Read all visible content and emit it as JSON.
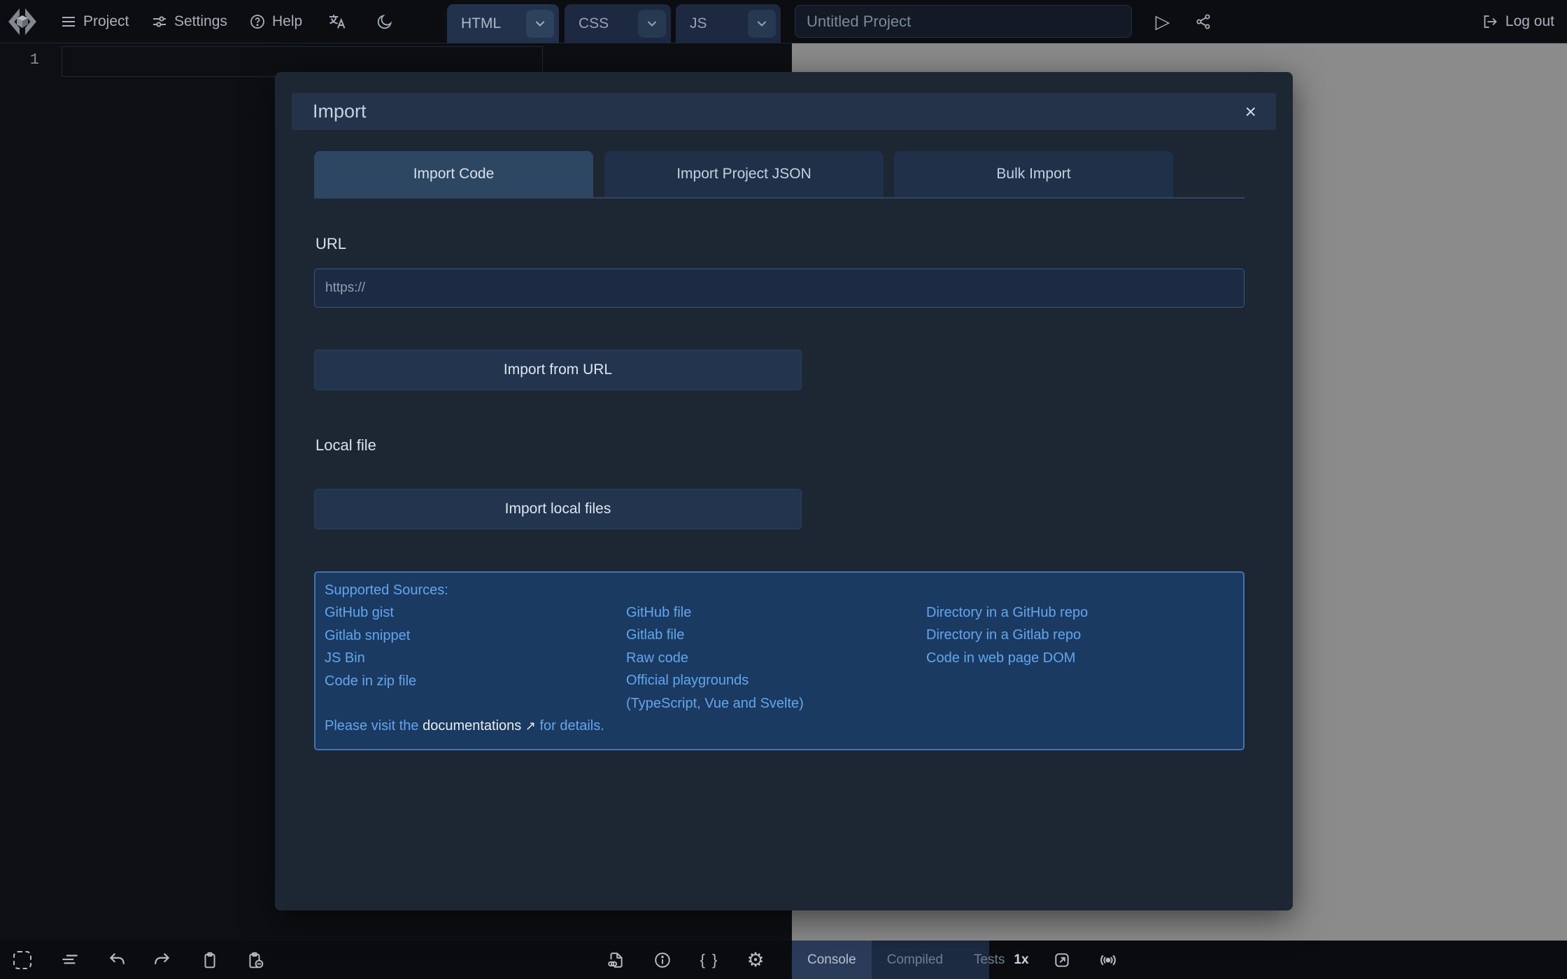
{
  "topbar": {
    "menus": [
      {
        "label": "Project",
        "icon": "menu-icon"
      },
      {
        "label": "Settings",
        "icon": "sliders-icon"
      },
      {
        "label": "Help",
        "icon": "question-circle-icon"
      }
    ],
    "editor_tabs": [
      {
        "label": "HTML",
        "active": true
      },
      {
        "label": "CSS",
        "active": false
      },
      {
        "label": "JS",
        "active": false
      }
    ],
    "project_title": {
      "value": "",
      "placeholder": "Untitled Project"
    },
    "logout_label": "Log out"
  },
  "editor": {
    "line_number": "1"
  },
  "modal": {
    "title": "Import",
    "tabs": [
      {
        "label": "Import Code",
        "active": true
      },
      {
        "label": "Import Project JSON",
        "active": false
      },
      {
        "label": "Bulk Import",
        "active": false
      }
    ],
    "url_label": "URL",
    "url_input": {
      "value": "",
      "placeholder": "https://"
    },
    "import_url_button": "Import from URL",
    "local_file_label": "Local file",
    "import_local_button": "Import local files",
    "sources": {
      "heading": "Supported Sources:",
      "col1": [
        "GitHub gist",
        "Gitlab snippet",
        "JS Bin",
        "Code in zip file"
      ],
      "col2": [
        "GitHub file",
        "Gitlab file",
        "Raw code",
        "Official playgrounds",
        "(TypeScript, Vue and Svelte)"
      ],
      "col3": [
        "Directory in a GitHub repo",
        "Directory in a Gitlab repo",
        "Code in web page DOM"
      ],
      "footer_pre": "Please visit the ",
      "footer_link": "documentations",
      "footer_arrow": "↗",
      "footer_post": " for details."
    }
  },
  "statusbar": {
    "result_tabs": [
      {
        "label": "Console",
        "active": true
      },
      {
        "label": "Compiled",
        "active": false
      },
      {
        "label": "Tests",
        "active": false
      }
    ],
    "zoom_label": "1x"
  },
  "icons": {
    "close": "×",
    "play": "▷",
    "braces": "{ }",
    "gear": "⚙",
    "left_toolbar": [
      "select-all",
      "format",
      "undo",
      "redo",
      "copy",
      "paste"
    ],
    "middle_toolbar": [
      "external-resources",
      "info",
      "custom-settings",
      "editor-settings"
    ],
    "right_toolbar": [
      "open-in-new-window",
      "broadcast"
    ]
  },
  "colors": {
    "link_blue": "#63a6ec",
    "result_background": "#8b8b8b",
    "modal_background": "#1d2734",
    "sources_box_background": "#1b3a61",
    "sources_box_border": "#3f74ad",
    "active_tab": "#2d4763"
  }
}
